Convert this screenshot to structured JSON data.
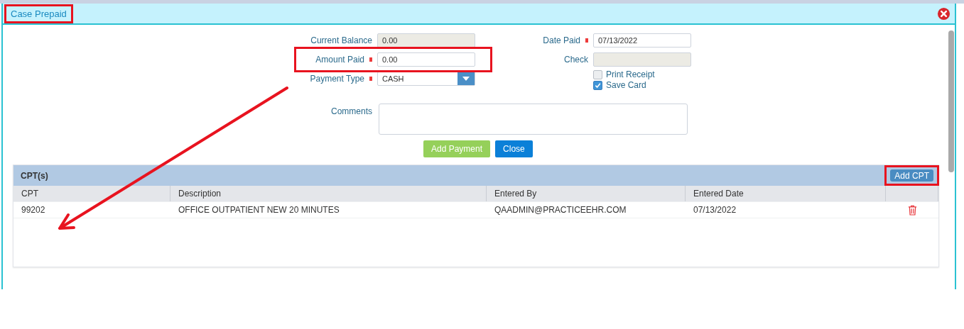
{
  "dialog": {
    "title": "Case Prepaid",
    "title_highlighted": true
  },
  "form": {
    "left": [
      {
        "kind": "text",
        "label": "Current Balance",
        "value": "0.00",
        "disabled": true
      },
      {
        "kind": "text",
        "label": "Amount Paid",
        "value": "0.00",
        "required": true,
        "disabled": false,
        "highlighted": true
      },
      {
        "kind": "select",
        "label": "Payment Type",
        "value": "CASH",
        "required": true,
        "disabled": false
      }
    ],
    "right": [
      {
        "kind": "text",
        "label": "Date Paid",
        "value": "07/13/2022",
        "required": true,
        "disabled": false
      },
      {
        "kind": "text",
        "label": "Check",
        "disabled": true
      }
    ],
    "checkboxes": [
      {
        "label": "Print Receipt",
        "checked": false,
        "disabled": true
      },
      {
        "label": "Save Card",
        "checked": true
      }
    ],
    "comments": {
      "label": "Comments"
    },
    "buttons": [
      {
        "label": "Add Payment",
        "kind": "success"
      },
      {
        "label": "Close",
        "kind": "primary"
      }
    ]
  },
  "cpt_panel": {
    "title": "CPT(s)",
    "add_button": {
      "label": "Add CPT",
      "highlighted": true
    },
    "columns": [
      "CPT",
      "Description",
      "Entered By",
      "Entered Date"
    ],
    "rows": [
      {
        "cells": [
          "99202",
          "OFFICE OUTPATIENT NEW 20 MINUTES",
          "QAADMIN@PRACTICEEHR.COM",
          "07/13/2022"
        ],
        "deletable": true
      }
    ]
  }
}
